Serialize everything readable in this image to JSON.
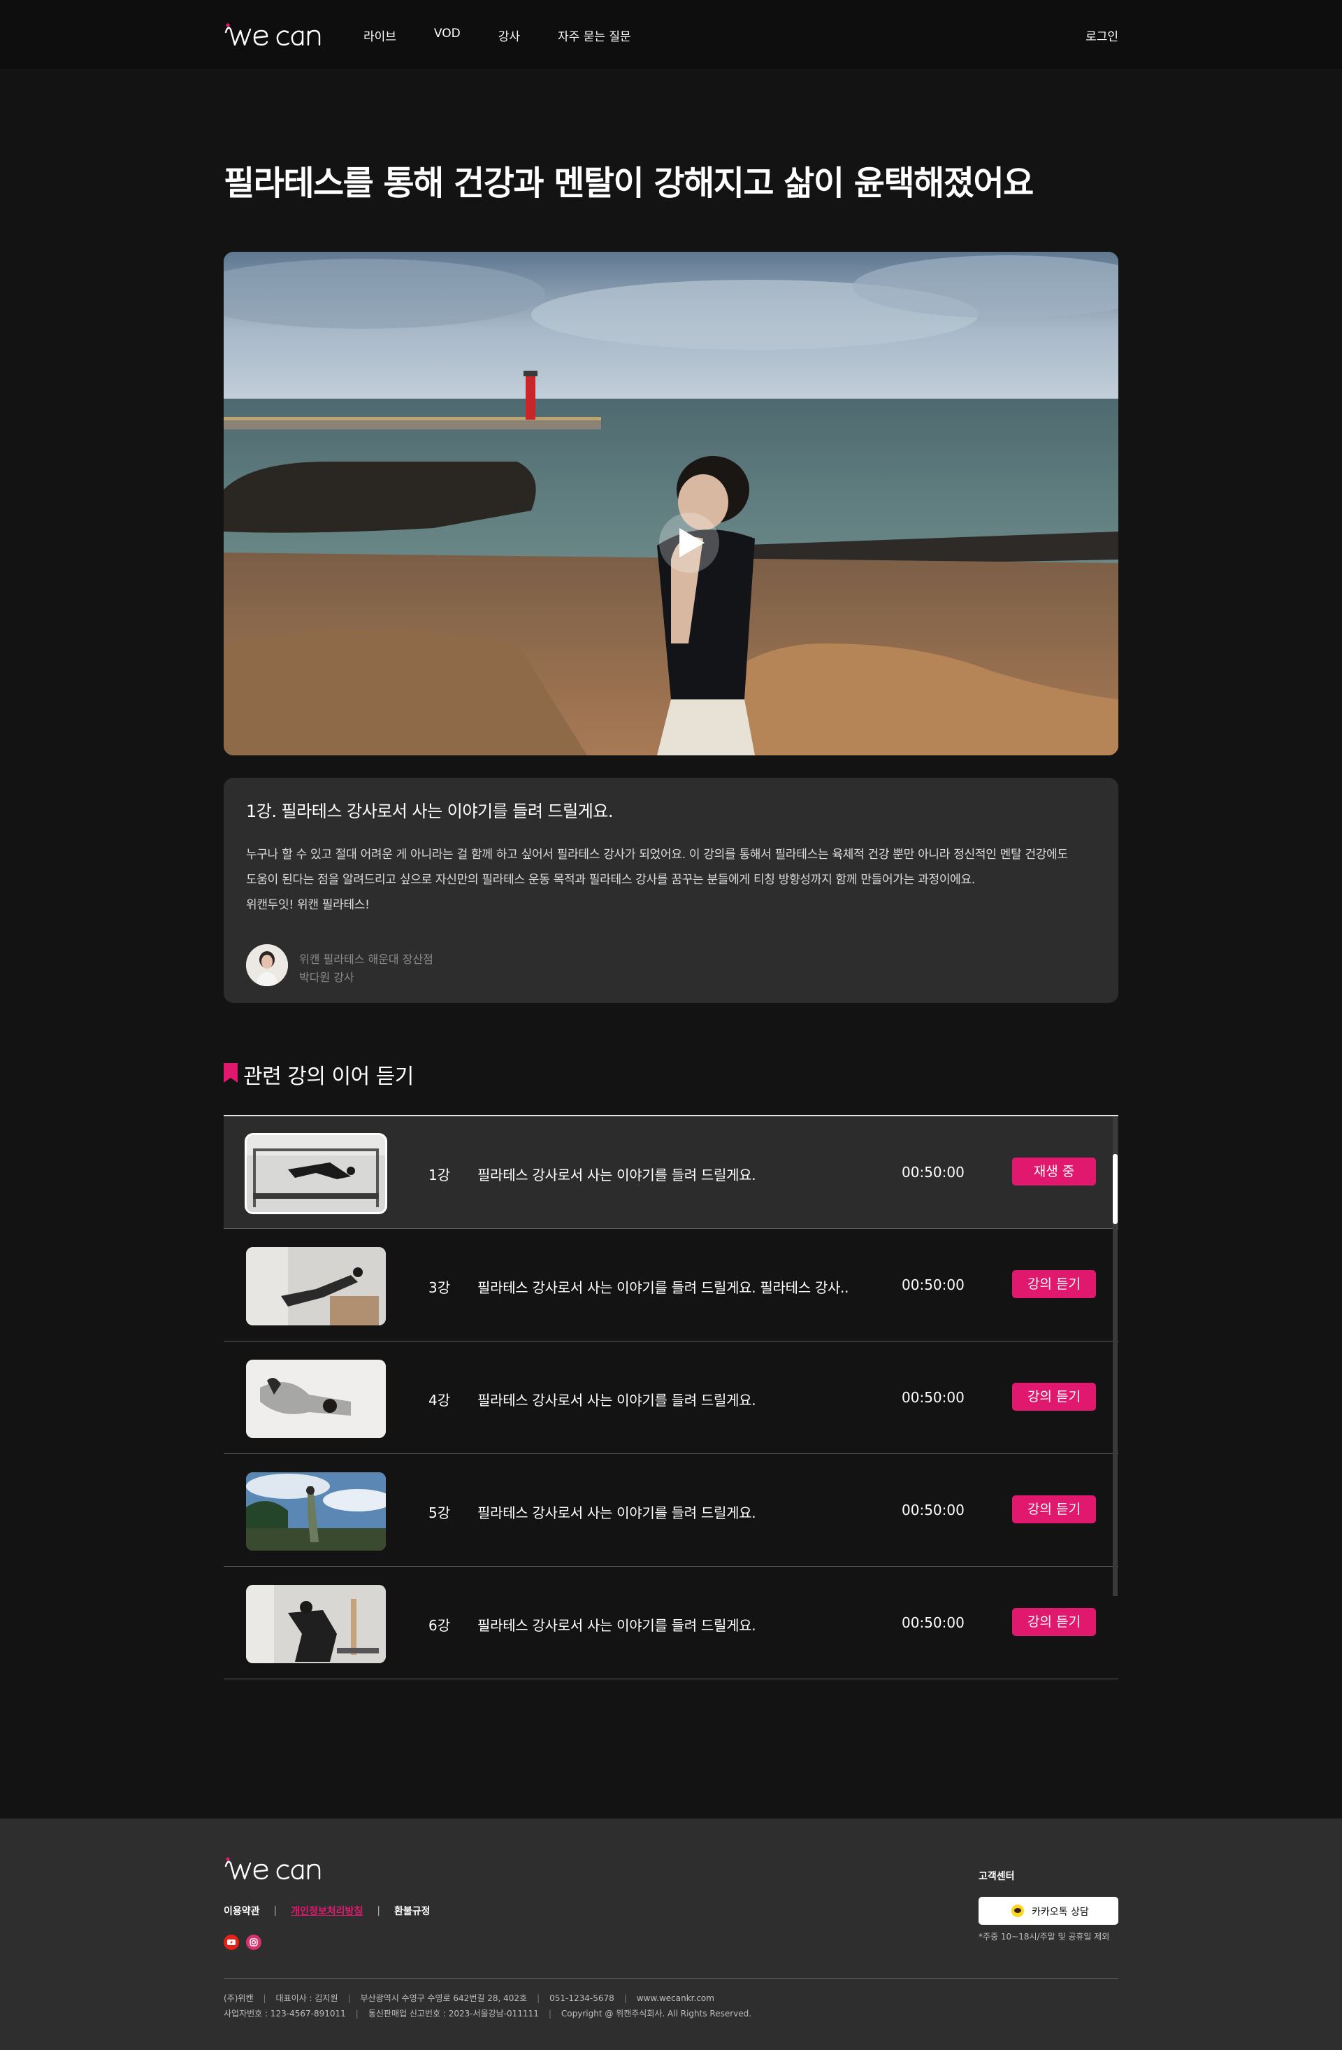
{
  "header": {
    "brand": "we can",
    "nav": [
      "라이브",
      "VOD",
      "강사",
      "자주 묻는 질문"
    ],
    "login": "로그인"
  },
  "page": {
    "title": "필라테스를 통해 건강과 멘탈이 강해지고 삶이 윤택해졌어요"
  },
  "lecture": {
    "title": "1강. 필라테스 강사로서 사는 이야기를 들려 드릴게요.",
    "description": [
      "누구나 할 수 있고 절대 어려운 게 아니라는 걸 함께 하고 싶어서 필라테스 강사가 되었어요. 이 강의를 통해서 필라테스는 육체적 건강 뿐만 아니라 정신적인 멘탈 건강에도",
      "도움이 된다는 점을 알려드리고 싶으로 자신만의 필라테스 운동 목적과 필라테스 강사를 꿈꾸는 분들에게 티칭 방향성까지 함께 만들어가는 과정이에요.",
      "위캔두잇! 위캔 필라테스!"
    ],
    "teacher": {
      "branch": "위캔 필라테스 해운대 장산점",
      "name": "박다원 강사"
    }
  },
  "related": {
    "title": "관련 강의 이어 듣기",
    "items": [
      {
        "ep": "1강",
        "title": "필라테스 강사로서 사는 이야기를 들려 드릴게요.",
        "duration": "00:50:00",
        "button": "재생 중",
        "active": true
      },
      {
        "ep": "3강",
        "title": "필라테스 강사로서 사는 이야기를 들려 드릴게요. 필라테스 강사..",
        "duration": "00:50:00",
        "button": "강의 듣기",
        "active": false
      },
      {
        "ep": "4강",
        "title": "필라테스 강사로서 사는 이야기를 들려 드릴게요.",
        "duration": "00:50:00",
        "button": "강의 듣기",
        "active": false
      },
      {
        "ep": "5강",
        "title": "필라테스 강사로서 사는 이야기를 들려 드릴게요.",
        "duration": "00:50:00",
        "button": "강의 듣기",
        "active": false
      },
      {
        "ep": "6강",
        "title": "필라테스 강사로서 사는 이야기를 들려 드릴게요.",
        "duration": "00:50:00",
        "button": "강의 듣기",
        "active": false
      }
    ]
  },
  "footer": {
    "brand": "we can",
    "links": [
      "이용약관",
      "개인정보처리방침",
      "환불규정"
    ],
    "cs_title": "고객센터",
    "kakao_label": "카카오톡 상담",
    "cs_note": "*주중 10~18시/주말 및 공휴일 제외",
    "info_line1": [
      "(주)위캔",
      "대표이사 : 김지원",
      "부산광역시 수영구 수영로 642번길 28, 402호",
      "051-1234-5678",
      "www.wecankr.com"
    ],
    "info_line2": [
      "사업자번호 : 123-4567-891011",
      "통신판매업 신고번호 : 2023-서울강남-011111",
      "Copyright @ 위캔주식회사. All Rights Reserved."
    ]
  },
  "colors": {
    "accent": "#e0186e",
    "background": "#131313",
    "card": "#2d2d2d"
  }
}
